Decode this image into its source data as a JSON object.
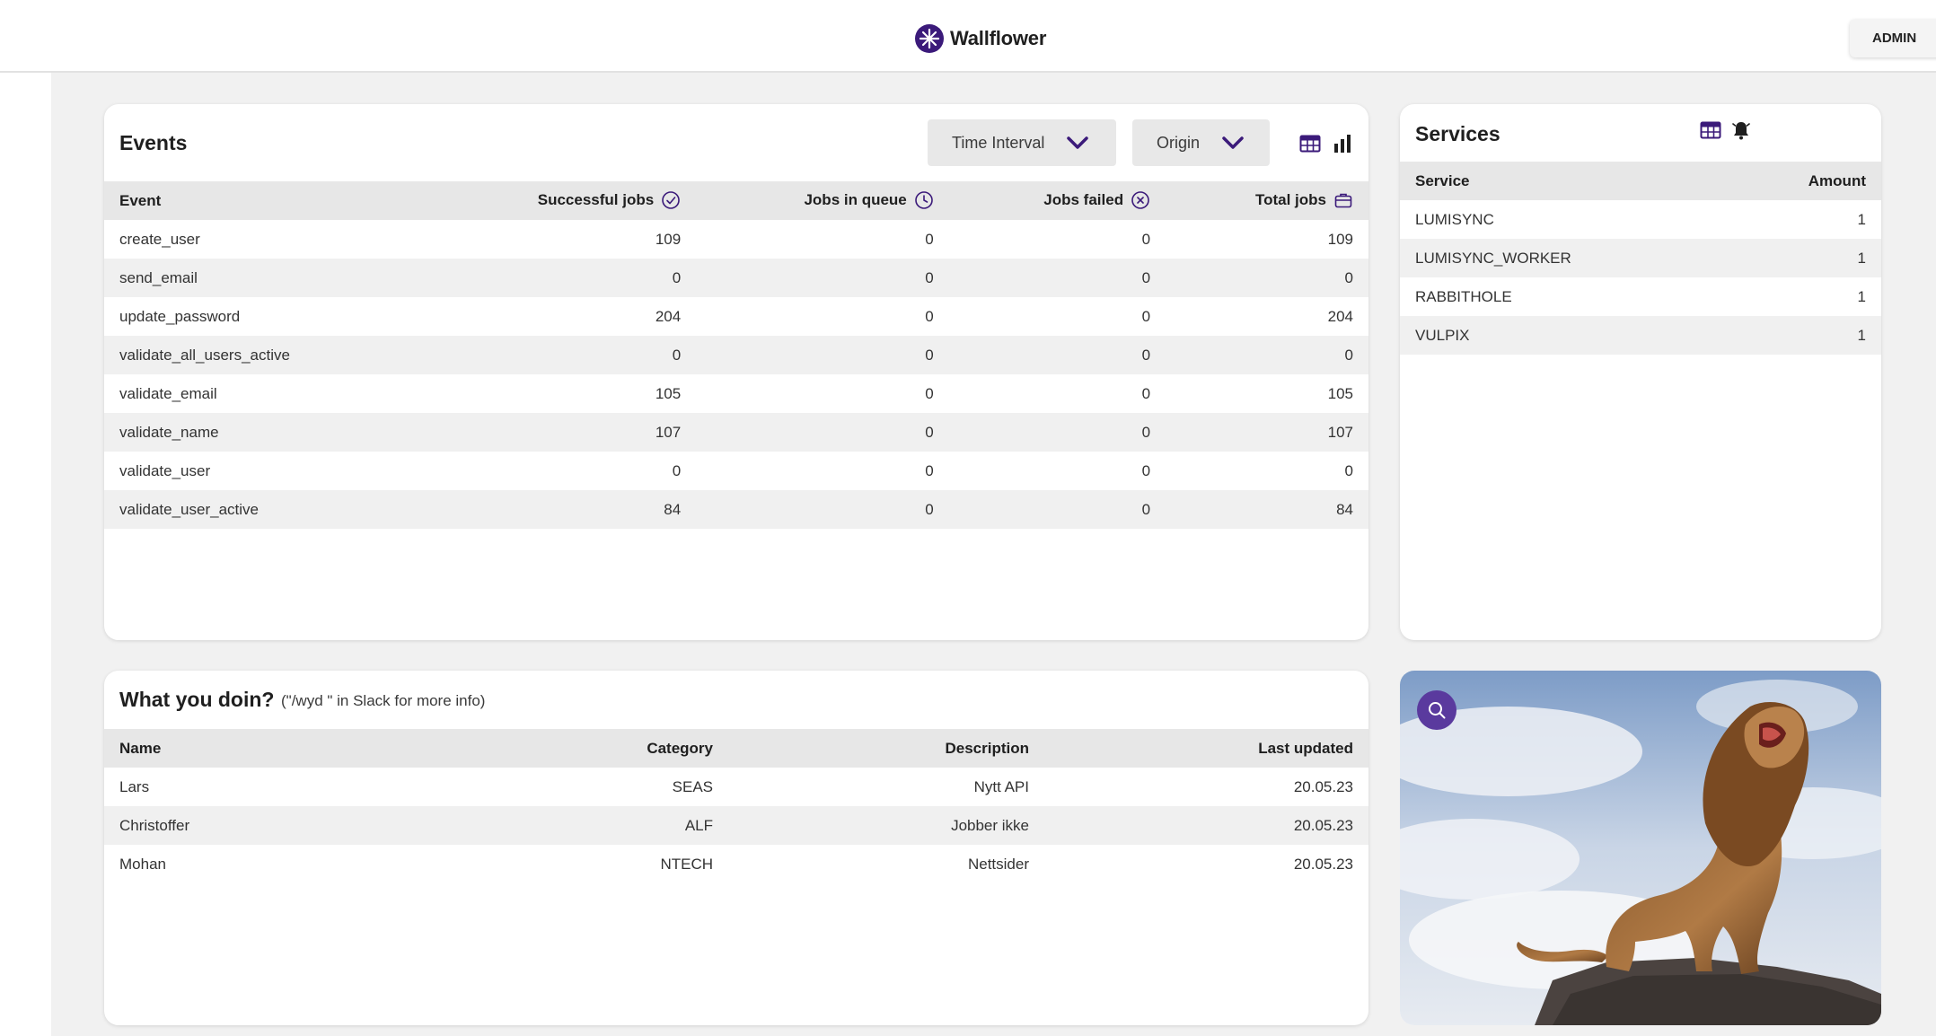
{
  "app": {
    "brand_name": "Wallflower",
    "admin_label": "ADMIN",
    "accent_color": "#3b1a7a"
  },
  "events": {
    "title": "Events",
    "filters": {
      "time_interval": "Time Interval",
      "origin": "Origin"
    },
    "view_icons": [
      "table-icon",
      "bar-chart-icon"
    ],
    "columns": {
      "event": "Event",
      "successful": "Successful jobs",
      "queue": "Jobs in queue",
      "failed": "Jobs failed",
      "total": "Total jobs"
    },
    "column_icons": [
      "check-circle-icon",
      "clock-icon",
      "x-circle-icon",
      "briefcase-icon"
    ],
    "rows": [
      {
        "event": "create_user",
        "successful": "109",
        "queue": "0",
        "failed": "0",
        "total": "109"
      },
      {
        "event": "send_email",
        "successful": "0",
        "queue": "0",
        "failed": "0",
        "total": "0"
      },
      {
        "event": "update_password",
        "successful": "204",
        "queue": "0",
        "failed": "0",
        "total": "204"
      },
      {
        "event": "validate_all_users_active",
        "successful": "0",
        "queue": "0",
        "failed": "0",
        "total": "0"
      },
      {
        "event": "validate_email",
        "successful": "105",
        "queue": "0",
        "failed": "0",
        "total": "105"
      },
      {
        "event": "validate_name",
        "successful": "107",
        "queue": "0",
        "failed": "0",
        "total": "107"
      },
      {
        "event": "validate_user",
        "successful": "0",
        "queue": "0",
        "failed": "0",
        "total": "0"
      },
      {
        "event": "validate_user_active",
        "successful": "84",
        "queue": "0",
        "failed": "0",
        "total": "84"
      }
    ]
  },
  "services": {
    "title": "Services",
    "view_icons": [
      "table-icon",
      "bell-icon"
    ],
    "columns": {
      "service": "Service",
      "amount": "Amount"
    },
    "rows": [
      {
        "service": "LUMISYNC",
        "amount": "1"
      },
      {
        "service": "LUMISYNC_WORKER",
        "amount": "1"
      },
      {
        "service": "RABBITHOLE",
        "amount": "1"
      },
      {
        "service": "VULPIX",
        "amount": "1"
      }
    ]
  },
  "wyd": {
    "title": "What you doin?",
    "hint": "(\"/wyd \" in Slack for more info)",
    "columns": {
      "name": "Name",
      "category": "Category",
      "description": "Description",
      "last_updated": "Last updated"
    },
    "rows": [
      {
        "name": "Lars",
        "category": "SEAS",
        "description": "Nytt API",
        "last_updated": "20.05.23"
      },
      {
        "name": "Christoffer",
        "category": "ALF",
        "description": "Jobber ikke",
        "last_updated": "20.05.23"
      },
      {
        "name": "Mohan",
        "category": "NTECH",
        "description": "Nettsider",
        "last_updated": "20.05.23"
      }
    ]
  },
  "image_card": {
    "search_icon": "search-icon"
  }
}
